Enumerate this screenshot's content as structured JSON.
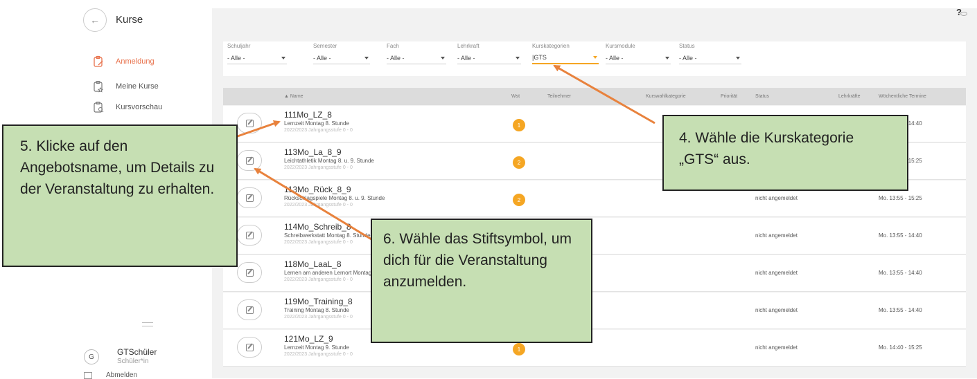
{
  "sidebar": {
    "back_label": "←",
    "title": "Kurse",
    "items": [
      {
        "label": "Anmeldung",
        "icon": "clipboard-pen-icon",
        "active": true
      },
      {
        "label": "Meine Kurse",
        "icon": "clipboard-star-icon",
        "active": false
      },
      {
        "label": "Kursvorschau",
        "icon": "clipboard-search-icon",
        "active": false
      }
    ],
    "user": {
      "initial": "G",
      "name": "GTSchüler",
      "role": "Schüler*in"
    },
    "logout_label": "Abmelden"
  },
  "topbar": {
    "help_label": "?",
    "visibility_icon": "eye-slash-icon"
  },
  "filters": [
    {
      "label": "Schuljahr",
      "value": "- Alle -"
    },
    {
      "label": "Semester",
      "value": "- Alle -"
    },
    {
      "label": "Fach",
      "value": "- Alle -"
    },
    {
      "label": "Lehrkraft",
      "value": "- Alle -"
    },
    {
      "label": "Kurskategorien",
      "value": "|GTS"
    },
    {
      "label": "Kursmodule",
      "value": "- Alle -"
    },
    {
      "label": "Status",
      "value": "- Alle -"
    }
  ],
  "table": {
    "headers": {
      "name": "▲ Name",
      "wst": "Wst",
      "teilnehmer": "Teilnehmer",
      "kurswahl": "Kurswahlkategorie",
      "prioritaet": "Priorität",
      "status": "Status",
      "lehrkraefte": "Lehrkräfte",
      "termine": "Wöchentliche Termine"
    },
    "rows": [
      {
        "code": "111Mo_LZ_8",
        "desc": "Lernzeit Montag 8. Stunde",
        "sub": "2022/2023 Jahrgangsstufe 0 - 0",
        "wst": "1",
        "status": "",
        "time": "Mo. 13:55 - 14:40"
      },
      {
        "code": "113Mo_La_8_9",
        "desc": "Leichtathletik Montag 8. u. 9. Stunde",
        "sub": "2022/2023 Jahrgangsstufe 0 - 0",
        "wst": "2",
        "status": "",
        "time": "Mo. 13:55 - 15:25"
      },
      {
        "code": "113Mo_Rück_8_9",
        "desc": "Rückschlagspiele Montag 8. u. 9. Stunde",
        "sub": "2022/2023 Jahrgangsstufe 0 - 0",
        "wst": "2",
        "status": "nicht angemeldet",
        "time": "Mo. 13:55 - 15:25"
      },
      {
        "code": "114Mo_Schreib_8",
        "desc": "Schreibwerkstatt Montag 8. Stunde",
        "sub": "2022/2023 Jahrgangsstufe 0 - 0",
        "wst": "",
        "status": "nicht angemeldet",
        "time": "Mo. 13:55 - 14:40"
      },
      {
        "code": "118Mo_LaaL_8",
        "desc": "Lernen am anderen Lernort Montag 8. Stunde",
        "sub": "2022/2023 Jahrgangsstufe 0 - 0",
        "wst": "",
        "status": "nicht angemeldet",
        "time": "Mo. 13:55 - 14:40"
      },
      {
        "code": "119Mo_Training_8",
        "desc": "Training Montag 8. Stunde",
        "sub": "2022/2023 Jahrgangsstufe 0 - 0",
        "wst": "",
        "status": "nicht angemeldet",
        "time": "Mo. 13:55 - 14:40"
      },
      {
        "code": "121Mo_LZ_9",
        "desc": "Lernzeit Montag 9. Stunde",
        "sub": "2022/2023 Jahrgangsstufe 0 - 0",
        "wst": "1",
        "status": "nicht angemeldet",
        "time": "Mo. 14:40 - 15:25"
      }
    ]
  },
  "callouts": {
    "step4": "4. Wähle die Kurskategorie „GTS“ aus.",
    "step5": "5. Klicke auf den Angebotsname, um Details zu der Veranstaltung zu erhalten.",
    "step6": "6. Wähle das Stiftsymbol, um dich für die Veranstaltung anzumelden."
  },
  "colors": {
    "accent": "#e8704a",
    "badge": "#f5a623",
    "callout_fill": "#c6dfb3",
    "arrow": "#e8823d"
  }
}
